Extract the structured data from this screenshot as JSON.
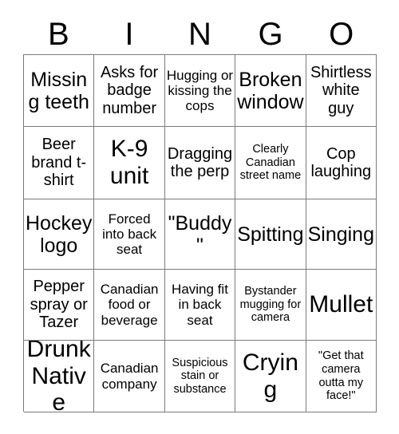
{
  "card": {
    "type": "bingo-card",
    "columns": 5,
    "rows": 5,
    "header_letters": [
      "B",
      "I",
      "N",
      "G",
      "O"
    ],
    "border_color": "#7a7a7a",
    "text_color": "#000000",
    "background_color": "#ffffff"
  },
  "header": {
    "b": "B",
    "i": "I",
    "n": "N",
    "g": "G",
    "o": "O"
  },
  "cells": [
    {
      "text": "Missing teeth",
      "size": "lg"
    },
    {
      "text": "Asks for badge number",
      "size": "md"
    },
    {
      "text": "Hugging or kissing the cops",
      "size": "sm"
    },
    {
      "text": "Broken window",
      "size": "lg"
    },
    {
      "text": "Shirtless white guy",
      "size": "md"
    },
    {
      "text": "Beer brand t-shirt",
      "size": "md"
    },
    {
      "text": "K-9 unit",
      "size": "xl"
    },
    {
      "text": "Dragging the perp",
      "size": "md"
    },
    {
      "text": "Clearly Canadian street name",
      "size": "xs"
    },
    {
      "text": "Cop laughing",
      "size": "md"
    },
    {
      "text": "Hockey logo",
      "size": "lg"
    },
    {
      "text": "Forced into back seat",
      "size": "sm"
    },
    {
      "text": "\"Buddy\"",
      "size": "lg"
    },
    {
      "text": "Spitting",
      "size": "lg"
    },
    {
      "text": "Singing",
      "size": "lg"
    },
    {
      "text": "Pepper spray or Tazer",
      "size": "md"
    },
    {
      "text": "Canadian food or beverage",
      "size": "sm"
    },
    {
      "text": "Having fit in back seat",
      "size": "sm"
    },
    {
      "text": "Bystander mugging for camera",
      "size": "xs"
    },
    {
      "text": "Mullet",
      "size": "xl"
    },
    {
      "text": "Drunk Native",
      "size": "xl"
    },
    {
      "text": "Canadian company",
      "size": "sm"
    },
    {
      "text": "Suspicious stain or substance",
      "size": "xs"
    },
    {
      "text": "Crying",
      "size": "xl"
    },
    {
      "text": "\"Get that camera outta my face!\"",
      "size": "xs"
    }
  ]
}
